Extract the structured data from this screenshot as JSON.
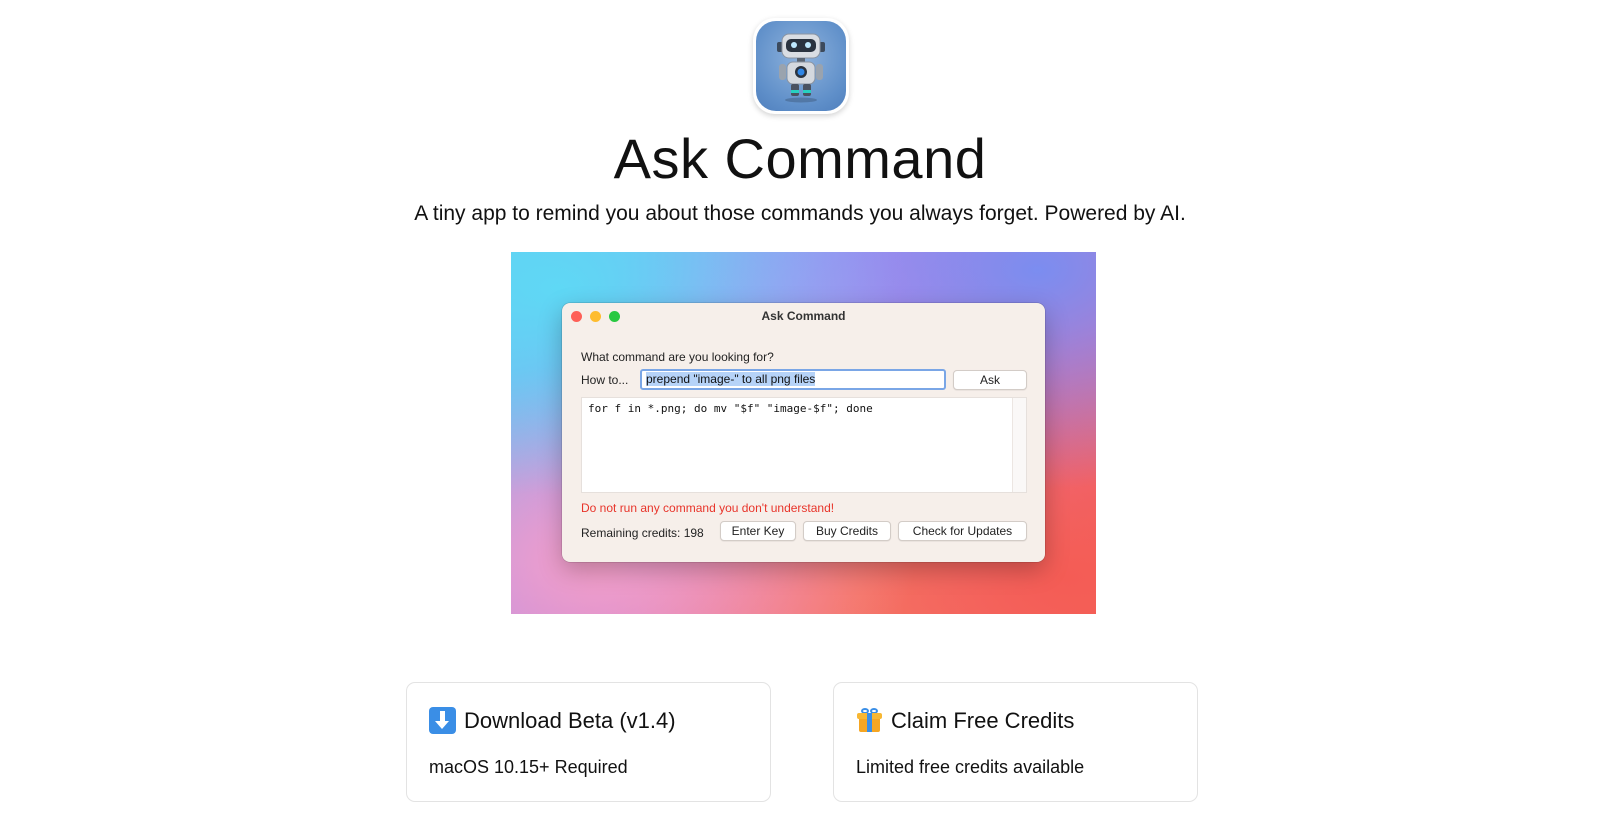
{
  "header": {
    "app_icon": "robot-icon",
    "title": "Ask Command",
    "tagline": "A tiny app to remind you about those commands you always forget. Powered by AI."
  },
  "screenshot": {
    "window_title": "Ask Command",
    "prompt_label": "What command are you looking for?",
    "howto_label": "How to...",
    "query_value": "prepend \"image-\" to all png files",
    "ask_label": "Ask",
    "output": "for f in *.png; do mv \"$f\" \"image-$f\"; done",
    "warning": "Do not run any command you don't understand!",
    "credits_text": "Remaining credits: 198",
    "enter_key_label": "Enter Key",
    "buy_credits_label": "Buy Credits",
    "check_updates_label": "Check for Updates",
    "colors": {
      "close": "#fe5f57",
      "minimize": "#febc2e",
      "zoom": "#28c840",
      "warning": "#e8342a"
    }
  },
  "cards": {
    "download": {
      "icon": "download-arrow-icon",
      "title": "Download Beta (v1.4)",
      "subtitle": "macOS 10.15+ Required"
    },
    "credits": {
      "icon": "gift-icon",
      "title": "Claim Free Credits",
      "subtitle": "Limited free credits available"
    }
  }
}
